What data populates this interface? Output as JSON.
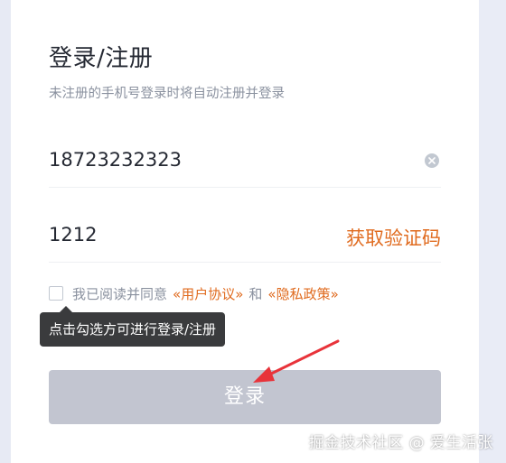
{
  "form": {
    "title": "登录/注册",
    "subtitle": "未注册的手机号登录时将自动注册并登录",
    "phone_value": "18723232323",
    "code_value": "1212",
    "get_code_label": "获取验证码",
    "clear_icon": "clear-circle-icon"
  },
  "agreement": {
    "prefix": "我已阅读并同意",
    "user_agreement": "«用户协议»",
    "and_text": "和",
    "privacy_policy": "«隐私政策»",
    "checked": false
  },
  "tooltip": {
    "text": "点击勾选方可进行登录/注册"
  },
  "login_button": {
    "label": "登录"
  },
  "watermark": {
    "text": "掘金技术社区 @ 爱生活张"
  },
  "colors": {
    "accent": "#e06b1f",
    "button_disabled": "#c2c5d0",
    "annotation_arrow": "#e8333a"
  }
}
